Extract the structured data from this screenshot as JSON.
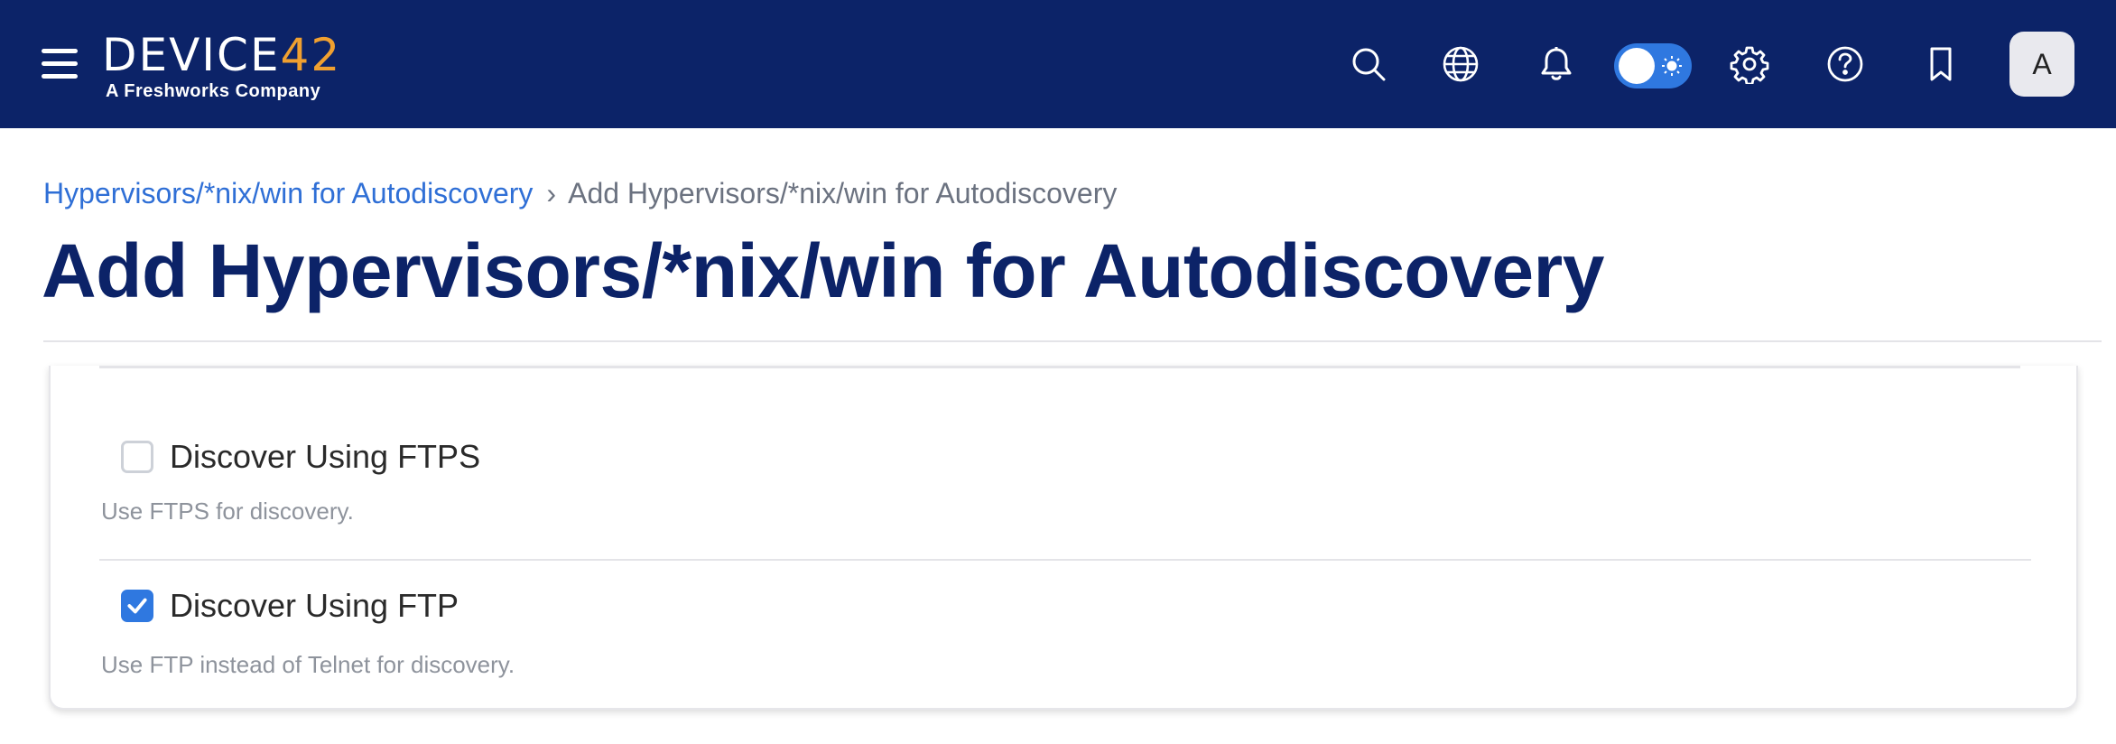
{
  "header": {
    "brand_word": "DEVICE",
    "brand_num": "42",
    "brand_sub": "A Freshworks Company",
    "brand_accent_color": "#f0a030",
    "background_color": "#0c2368",
    "icons": [
      "menu-icon",
      "search-icon",
      "globe-icon",
      "bell-icon",
      "theme-toggle",
      "gear-icon",
      "help-icon",
      "bookmark-icon"
    ],
    "theme_toggle_state": "light",
    "avatar_initial": "A"
  },
  "breadcrumb": {
    "parent": "Hypervisors/*nix/win for Autodiscovery",
    "separator": "›",
    "current": "Add Hypervisors/*nix/win for Autodiscovery"
  },
  "page": {
    "title": "Add Hypervisors/*nix/win for Autodiscovery"
  },
  "form": {
    "options": [
      {
        "label": "Discover Using FTPS",
        "help": "Use FTPS for discovery.",
        "checked": false
      },
      {
        "label": "Discover Using FTP",
        "help": "Use FTP instead of Telnet for discovery.",
        "checked": true
      }
    ],
    "accent_color": "#2f78e0"
  }
}
